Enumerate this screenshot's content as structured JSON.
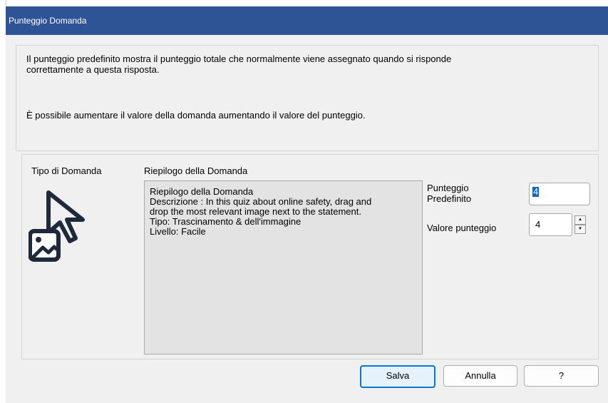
{
  "window": {
    "title": "Punteggio Domanda"
  },
  "info": {
    "line1": "Il punteggio predefinito mostra il punteggio totale che normalmente viene assegnato quando si risponde",
    "line2": "correttamente a questa risposta.",
    "line3": "È possibile aumentare il valore della domanda aumentando il valore del punteggio."
  },
  "question": {
    "type_label": "Tipo di Domanda",
    "icon": "drag-drop-image-icon",
    "summary_label": "Riepilogo della Domanda",
    "summary_lines": [
      "Riepilogo della Domanda",
      "Descrizione : In this quiz about online safety, drag and",
      "drop the most relevant image next to the statement.",
      "Tipo: Trascinamento & dell'immagine",
      "Livello: Facile"
    ]
  },
  "scores": {
    "default_label_line1": "Punteggio",
    "default_label_line2": "Predefinito",
    "default_value": "4",
    "score_label": "Valore punteggio",
    "score_value": "4"
  },
  "buttons": {
    "save": "Salva",
    "cancel": "Annulla",
    "help": "?"
  },
  "colors": {
    "titlebar": "#2f5496",
    "accent": "#0078d7",
    "icon": "#1e2a3c"
  }
}
